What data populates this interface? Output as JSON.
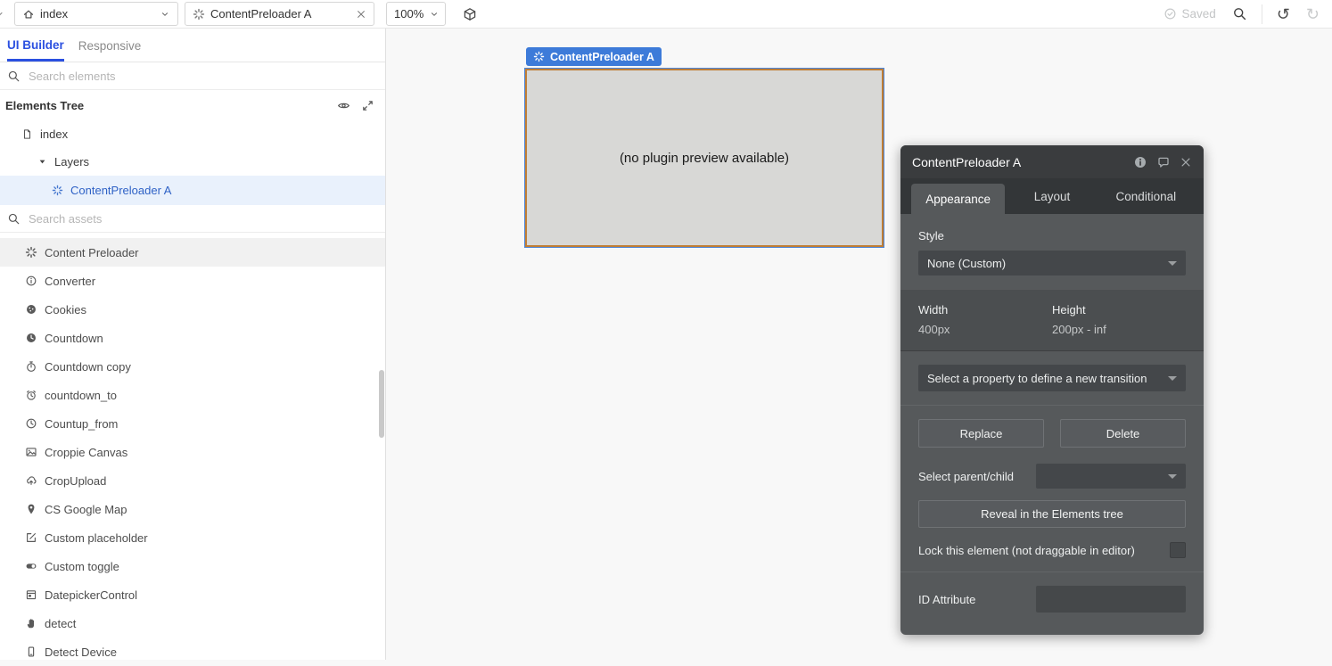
{
  "toolbar": {
    "page_selector": {
      "value": "index"
    },
    "element_tab": {
      "label": "ContentPreloader A"
    },
    "zoom_value": "100%",
    "saved_label": "Saved"
  },
  "sidebar": {
    "tabs": [
      {
        "label": "UI Builder",
        "active": true
      },
      {
        "label": "Responsive",
        "active": false
      }
    ],
    "search_elements_placeholder": "Search elements",
    "elements_tree_title": "Elements Tree",
    "tree": {
      "page_label": "index",
      "group_label": "Layers",
      "selected_layer_label": "ContentPreloader A"
    },
    "search_assets_placeholder": "Search assets",
    "assets": [
      {
        "label": "Content Preloader",
        "icon": "gear",
        "highlight": true
      },
      {
        "label": "Converter",
        "icon": "info-circle"
      },
      {
        "label": "Cookies",
        "icon": "cookie"
      },
      {
        "label": "Countdown",
        "icon": "clock-filled"
      },
      {
        "label": "Countdown copy",
        "icon": "stopwatch"
      },
      {
        "label": "countdown_to",
        "icon": "alarm-clock"
      },
      {
        "label": "Countup_from",
        "icon": "clock"
      },
      {
        "label": "Croppie Canvas",
        "icon": "image"
      },
      {
        "label": "CropUpload",
        "icon": "cloud-upload"
      },
      {
        "label": "CS Google Map",
        "icon": "map-pin"
      },
      {
        "label": "Custom placeholder",
        "icon": "edit-square"
      },
      {
        "label": "Custom toggle",
        "icon": "toggle"
      },
      {
        "label": "DatepickerControl",
        "icon": "calendar"
      },
      {
        "label": "detect",
        "icon": "hand"
      },
      {
        "label": "Detect Device",
        "icon": "phone"
      }
    ]
  },
  "canvas": {
    "element_label": "ContentPreloader A",
    "placeholder_text": "(no plugin preview available)"
  },
  "panel": {
    "title": "ContentPreloader A",
    "tabs": [
      {
        "label": "Appearance",
        "active": true
      },
      {
        "label": "Layout",
        "active": false
      },
      {
        "label": "Conditional",
        "active": false
      }
    ],
    "style_label": "Style",
    "style_value": "None (Custom)",
    "width_label": "Width",
    "width_value": "400px",
    "height_label": "Height",
    "height_value": "200px - inf",
    "transition_placeholder": "Select a property to define a new transition",
    "replace_label": "Replace",
    "delete_label": "Delete",
    "parent_child_label": "Select parent/child",
    "reveal_label": "Reveal in the Elements tree",
    "lock_label": "Lock this element (not draggable in editor)",
    "id_attribute_label": "ID Attribute"
  },
  "colors": {
    "accent_blue": "#2b50e0",
    "selection_blue": "#2f62c6",
    "selection_bg": "#e9f1fc",
    "element_label_blue": "#3d7bd9",
    "element_border_orange": "#c07e35",
    "element_outline_blue": "#4d86da",
    "element_fill": "#d8d8d6",
    "panel_header": "#3a3c3e",
    "panel_body": "#56595b",
    "panel_band": "#4b4e50",
    "panel_control": "#44474a",
    "canvas_bg": "#f8f8f8"
  }
}
